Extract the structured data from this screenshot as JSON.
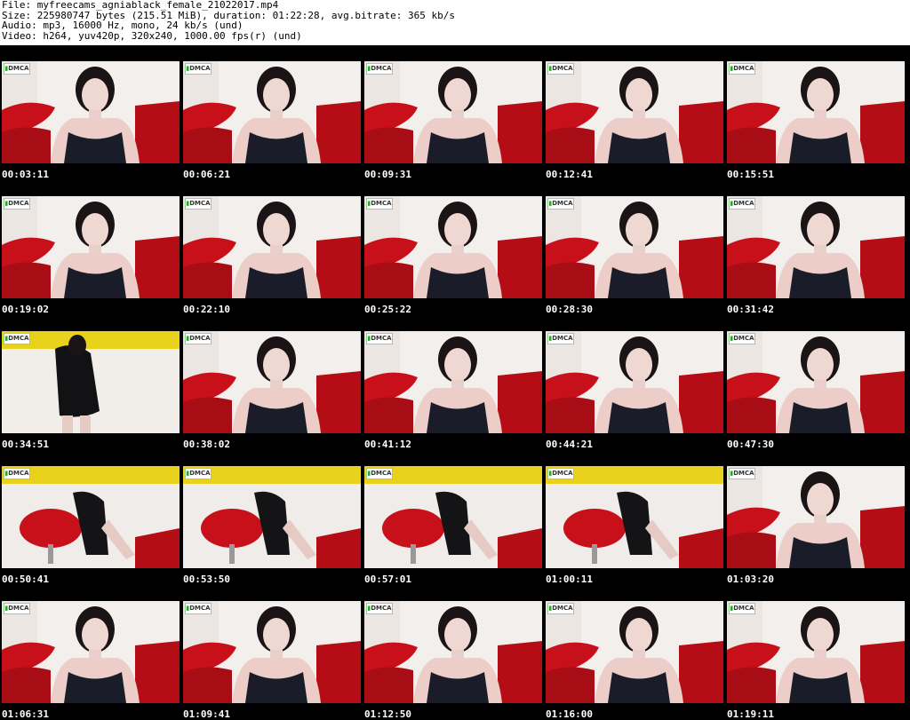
{
  "header": {
    "file": "File: myfreecams_agniablack_female_21022017.mp4",
    "size": "Size: 225980747 bytes (215.51 MiB), duration: 01:22:28, avg.bitrate: 365 kb/s",
    "audio": "Audio: mp3, 16000 Hz, mono, 24 kb/s (und)",
    "video": "Video: h264, yuv420p, 320x240, 1000.00 fps(r) (und)"
  },
  "watermark": "DMCA",
  "frames": [
    {
      "t": "00:03:11",
      "scene": "portrait"
    },
    {
      "t": "00:06:21",
      "scene": "portrait"
    },
    {
      "t": "00:09:31",
      "scene": "portrait"
    },
    {
      "t": "00:12:41",
      "scene": "portrait"
    },
    {
      "t": "00:15:51",
      "scene": "portrait"
    },
    {
      "t": "00:19:02",
      "scene": "portrait"
    },
    {
      "t": "00:22:10",
      "scene": "portrait"
    },
    {
      "t": "00:25:22",
      "scene": "portrait"
    },
    {
      "t": "00:28:30",
      "scene": "portrait"
    },
    {
      "t": "00:31:42",
      "scene": "portrait"
    },
    {
      "t": "00:34:51",
      "scene": "standing"
    },
    {
      "t": "00:38:02",
      "scene": "portrait"
    },
    {
      "t": "00:41:12",
      "scene": "portrait"
    },
    {
      "t": "00:44:21",
      "scene": "portrait"
    },
    {
      "t": "00:47:30",
      "scene": "portrait"
    },
    {
      "t": "00:50:41",
      "scene": "chair"
    },
    {
      "t": "00:53:50",
      "scene": "chair"
    },
    {
      "t": "00:57:01",
      "scene": "chair"
    },
    {
      "t": "01:00:11",
      "scene": "chair"
    },
    {
      "t": "01:03:20",
      "scene": "portrait"
    },
    {
      "t": "01:06:31",
      "scene": "portrait"
    },
    {
      "t": "01:09:41",
      "scene": "portrait"
    },
    {
      "t": "01:12:50",
      "scene": "portrait"
    },
    {
      "t": "01:16:00",
      "scene": "portrait"
    },
    {
      "t": "01:19:11",
      "scene": "portrait"
    }
  ]
}
